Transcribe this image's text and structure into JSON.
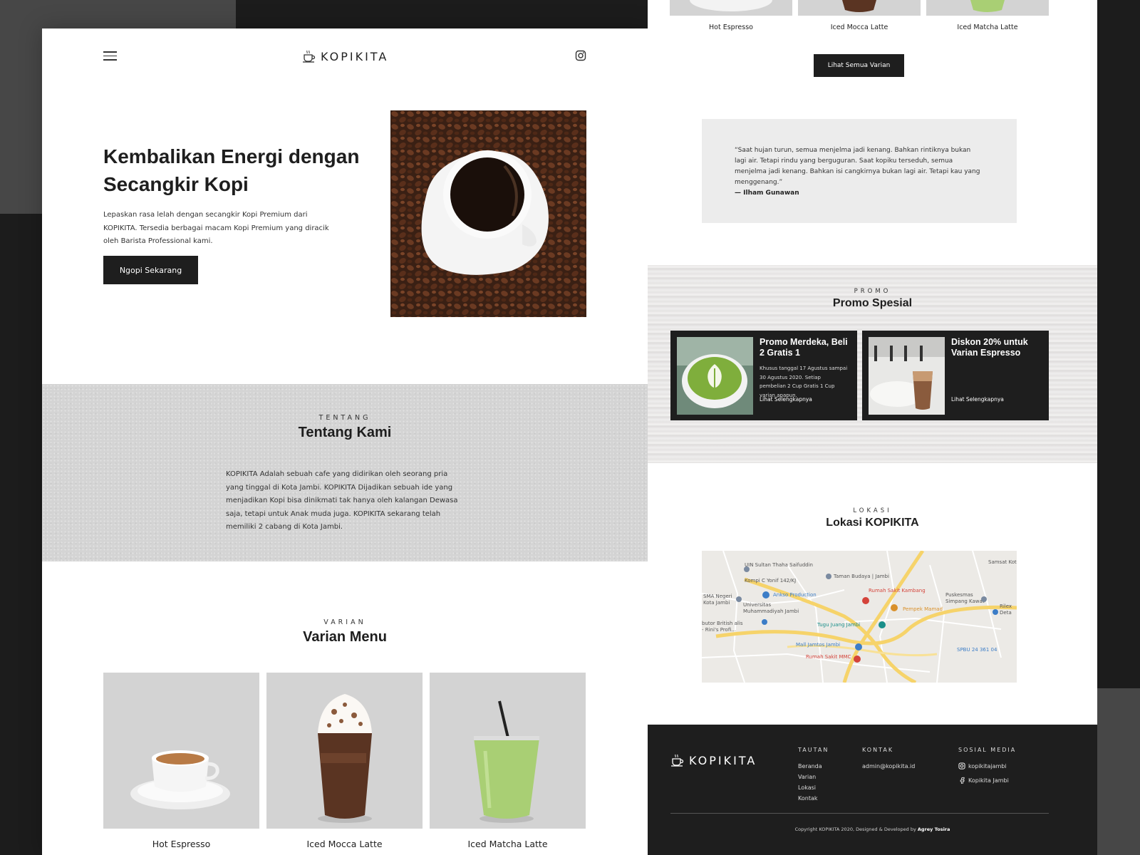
{
  "brand": {
    "name": "KOPIKITA"
  },
  "hero": {
    "title": "Kembalikan Energi dengan Secangkir Kopi",
    "description": "Lepaskan rasa lelah dengan secangkir Kopi Premium dari KOPIKITA. Tersedia berbagai macam Kopi Premium yang diracik oleh Barista Professional kami.",
    "cta": "Ngopi Sekarang"
  },
  "about": {
    "eyebrow": "TENTANG",
    "title": "Tentang Kami",
    "text": "KOPIKITA Adalah sebuah cafe yang didirikan oleh seorang pria yang tinggal di Kota Jambi. KOPIKITA Dijadikan sebuah ide yang menjadikan Kopi bisa dinikmati tak hanya oleh kalangan Dewasa saja, tetapi untuk Anak muda juga. KOPIKITA sekarang telah memiliki 2 cabang di Kota Jambi."
  },
  "menu": {
    "eyebrow": "VARIAN",
    "title": "Varian Menu",
    "items": [
      "Hot Espresso",
      "Iced Mocca Latte",
      "Iced Matcha Latte"
    ],
    "all_button": "Lihat Semua Varian"
  },
  "quote": {
    "text": "“Saat hujan turun, semua menjelma jadi kenang. Bahkan rintiknya bukan lagi air. Tetapi rindu yang berguguran. Saat kopiku terseduh, semua menjelma jadi kenang. Bahkan isi cangkirnya bukan lagi air. Tetapi kau yang menggenang.”",
    "author": "— Ilham Gunawan"
  },
  "promo": {
    "eyebrow": "PROMO",
    "title": "Promo Spesial",
    "cards": [
      {
        "title": "Promo Merdeka, Beli 2 Gratis 1",
        "desc": "Khusus tanggal 17 Agustus sampai 30 Agustus 2020. Setiap pembelian 2 Cup Gratis 1 Cup varian apapun.",
        "link": "Lihat Selengkapnya"
      },
      {
        "title": "Diskon 20% untuk Varian Espresso",
        "desc": "",
        "link": "Lihat Selengkapnya"
      }
    ]
  },
  "location": {
    "eyebrow": "LOKASI",
    "title": "Lokasi KOPIKITA",
    "map_labels": [
      "UIN Sultan Thaha Saifuddin",
      "Kompi C Yonif 142/KJ",
      "Taman Budaya | Jambi",
      "Samsat Kota Jar",
      "SMA Negeri Kota Jambi",
      "Ankso Production",
      "Universitas Muhammadiyah Jambi",
      "Rumah Sakit Kambang",
      "Puskesmas Simpang Kawat",
      "Pempek Mamad",
      "butor British alis - Rini's Profi...",
      "Tugu Juang Jambi",
      "Mall Jamtos Jambi",
      "Rumah Sakit MMC",
      "SPBU 24 361 04",
      "Rilex Deta"
    ]
  },
  "footer": {
    "links_title": "TAUTAN",
    "links": [
      "Beranda",
      "Varian",
      "Lokasi",
      "Kontak"
    ],
    "contact_title": "KONTAK",
    "email": "admin@kopikita.id",
    "social_title": "SOSIAL MEDIA",
    "instagram": "kopikitajambi",
    "facebook": "Kopikita Jambi",
    "copyright": "Copyright KOPIKITA 2020, Designed & Developed by",
    "developer": "Agrey Tosira"
  },
  "colors": {
    "dark": "#1e1e1e",
    "gray_bg": "#d3d3d3",
    "quote_bg": "#ececec",
    "accent_map_yellow": "#f6d36a"
  }
}
